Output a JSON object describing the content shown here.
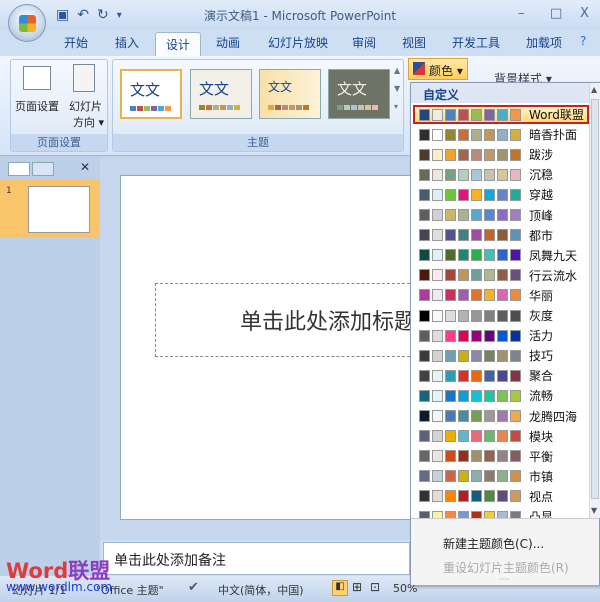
{
  "window": {
    "title": "演示文稿1 - Microsoft PowerPoint",
    "minimize": "–",
    "maximize": "□",
    "close": "X"
  },
  "tabs": [
    "开始",
    "插入",
    "设计",
    "动画",
    "幻灯片放映",
    "审阅",
    "视图",
    "开发工具",
    "加载项"
  ],
  "ribbon": {
    "page_setup": {
      "btn1": "页面设置",
      "btn2": "幻灯片",
      "btn2b": "方向 ▾",
      "label": "页面设置"
    },
    "themes": {
      "label": "主题",
      "sample": "文文"
    },
    "colors_btn": "颜色 ▾",
    "bg_styles": "背景样式 ▾"
  },
  "slide": {
    "title_placeholder": "单击此处添加标题",
    "thumb_number": "1"
  },
  "notes": {
    "placeholder": "单击此处添加备注"
  },
  "status": {
    "slide": "幻灯片 1/1",
    "theme": "\"Office 主题\"",
    "language": "中文(简体，中国)",
    "zoom": "50%"
  },
  "watermark": {
    "brand": "Word联盟",
    "url": "www.wordlm.com"
  },
  "color_menu": {
    "header": "自定义",
    "schemes": [
      {
        "name": "Word联盟",
        "colors": [
          "#1f497d",
          "#eeece1",
          "#4f81bd",
          "#c0504d",
          "#9bbb59",
          "#8064a2",
          "#4bacc6",
          "#f79646"
        ]
      },
      {
        "name": "暗香扑面",
        "colors": [
          "#2f2f2f",
          "#ffffff",
          "#938734",
          "#cc6e36",
          "#afaf8f",
          "#c3975a",
          "#8fb1c3",
          "#d7af3a"
        ]
      },
      {
        "name": "跋涉",
        "colors": [
          "#4e3b30",
          "#fbeec9",
          "#f0a22e",
          "#a5644e",
          "#b58b80",
          "#c3986d",
          "#a19574",
          "#c17529"
        ]
      },
      {
        "name": "沉稳",
        "colors": [
          "#676a55",
          "#eae9e0",
          "#7a9e80",
          "#b1cfbd",
          "#a9c7d8",
          "#c4c5b0",
          "#d5c69b",
          "#e6b9c1"
        ]
      },
      {
        "name": "穿越",
        "colors": [
          "#475d70",
          "#dbeffb",
          "#6fc53a",
          "#e8127d",
          "#f8b323",
          "#12a9d8",
          "#6685c4",
          "#1cae9d"
        ]
      },
      {
        "name": "顶峰",
        "colors": [
          "#5f5f5f",
          "#d1d0d9",
          "#cdb665",
          "#a5b592",
          "#5ba8cc",
          "#5b85d1",
          "#8d6cc8",
          "#a37cc6"
        ]
      },
      {
        "name": "都市",
        "colors": [
          "#464653",
          "#dedede",
          "#53548a",
          "#438086",
          "#a04da3",
          "#c4652d",
          "#8b5d3d",
          "#5c92b5"
        ]
      },
      {
        "name": "凤舞九天",
        "colors": [
          "#0d4a44",
          "#dff1fb",
          "#4d6d2a",
          "#1d8a6e",
          "#2bb14a",
          "#3fc1b8",
          "#2d66c4",
          "#5312a6"
        ]
      },
      {
        "name": "行云流水",
        "colors": [
          "#4c1a08",
          "#fde9ec",
          "#a7423f",
          "#c09654",
          "#6fa09a",
          "#adbc8e",
          "#8e5f44",
          "#6c4f7e"
        ]
      },
      {
        "name": "华丽",
        "colors": [
          "#b03a94",
          "#f5e7ef",
          "#c8325a",
          "#a45cb3",
          "#e07230",
          "#f7b22a",
          "#d76ab2",
          "#f28a3b"
        ]
      },
      {
        "name": "灰度",
        "colors": [
          "#000000",
          "#f8f8f8",
          "#dddddd",
          "#b2b2b2",
          "#969696",
          "#808080",
          "#5f5f5f",
          "#4d4d4d"
        ]
      },
      {
        "name": "活力",
        "colors": [
          "#5e5e5e",
          "#dddddd",
          "#ff388c",
          "#e40059",
          "#9c007f",
          "#68007f",
          "#005bd3",
          "#00349e"
        ]
      },
      {
        "name": "技巧",
        "colors": [
          "#3b3b3b",
          "#d4d2d0",
          "#6ea0b0",
          "#ccaf0a",
          "#8d89a4",
          "#748560",
          "#9e9273",
          "#7e848d"
        ]
      },
      {
        "name": "聚合",
        "colors": [
          "#424242",
          "#e2f3f7",
          "#2e9dba",
          "#e12c2c",
          "#ea6812",
          "#3c66a2",
          "#484a8d",
          "#833446"
        ]
      },
      {
        "name": "流畅",
        "colors": [
          "#17667d",
          "#dff4fb",
          "#1a74c8",
          "#0aa0e0",
          "#14c0d8",
          "#1cc6a0",
          "#7cc458",
          "#a8c840"
        ]
      },
      {
        "name": "龙腾四海",
        "colors": [
          "#0c1b2a",
          "#f2f6fa",
          "#4a78b8",
          "#4a8ca0",
          "#75a053",
          "#9a9a9a",
          "#9c7ca8",
          "#f0a850"
        ]
      },
      {
        "name": "模块",
        "colors": [
          "#5a6378",
          "#d4d4d6",
          "#f0ad00",
          "#60b5cc",
          "#e66c7d",
          "#6bb76d",
          "#e88651",
          "#c64847"
        ]
      },
      {
        "name": "平衡",
        "colors": [
          "#666666",
          "#e8e6df",
          "#d34817",
          "#9b2d1f",
          "#a28e6a",
          "#956251",
          "#918485",
          "#855d5d"
        ]
      },
      {
        "name": "市镇",
        "colors": [
          "#646b86",
          "#c5d1d7",
          "#d16349",
          "#ccb400",
          "#8cadae",
          "#8c7b70",
          "#8fb08c",
          "#d19049"
        ]
      },
      {
        "name": "视点",
        "colors": [
          "#323232",
          "#e3ded1",
          "#ff8600",
          "#b61e25",
          "#1a5c7f",
          "#4e8b3e",
          "#604b7c",
          "#cd9c5c"
        ]
      },
      {
        "name": "凸显",
        "colors": [
          "#575f6d",
          "#fff39d",
          "#fe8637",
          "#7598d9",
          "#b32c16",
          "#f5cd2d",
          "#aebad5",
          "#777c84"
        ]
      }
    ],
    "new_colors": "新建主题颜色(C)...",
    "reset_colors": "重设幻灯片主题颜色(R)"
  }
}
